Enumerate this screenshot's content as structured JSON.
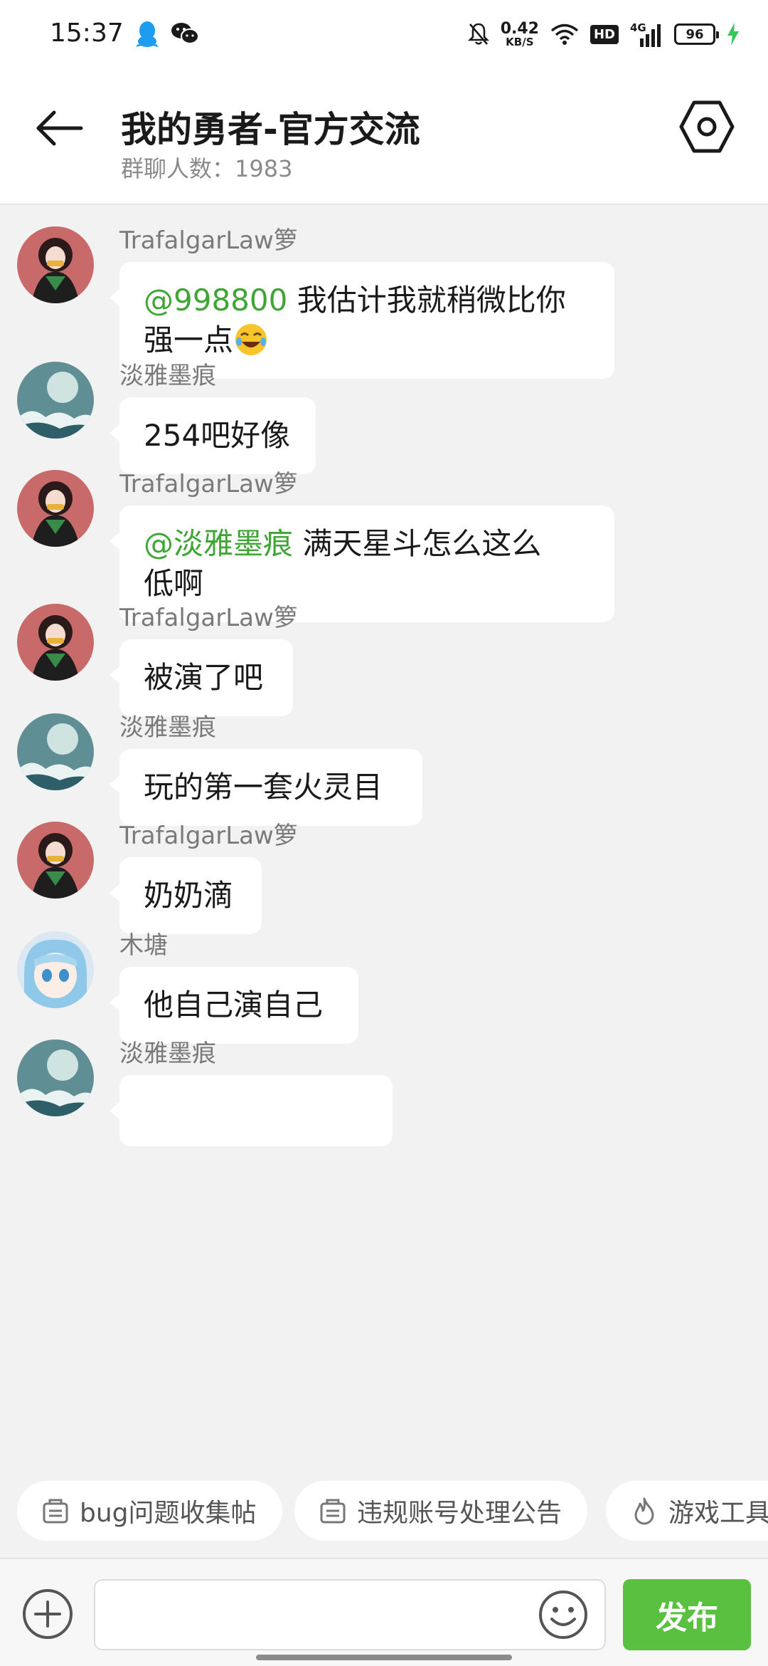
{
  "status_bar": {
    "time": "15:37",
    "net_speed_value": "0.42",
    "net_speed_unit": "KB/S",
    "hd_label": "HD",
    "network_label": "4G",
    "battery_level": "96",
    "icons": [
      "qq-icon",
      "wechat-icon",
      "mute-icon",
      "wifi-icon",
      "signal-icon",
      "charging-icon"
    ]
  },
  "header": {
    "title": "我的勇者-官方交流",
    "member_count": "群聊人数：1983"
  },
  "messages": [
    {
      "sender": "TrafalgarLaw箩",
      "mention": "@998800",
      "text": " 我估计我就稍微比你",
      "text2": "强一点",
      "emoji": "joy"
    },
    {
      "sender": "淡雅墨痕",
      "text": "254吧好像"
    },
    {
      "sender": "TrafalgarLaw箩",
      "mention": "@淡雅墨痕",
      "text": " 满天星斗怎么这么",
      "text2": "低啊"
    },
    {
      "sender": "TrafalgarLaw箩",
      "text": "被演了吧"
    },
    {
      "sender": "淡雅墨痕",
      "text": "玩的第一套火灵目"
    },
    {
      "sender": "TrafalgarLaw箩",
      "text": "奶奶滴"
    },
    {
      "sender": "木塘",
      "text": "他自己演自己"
    },
    {
      "sender": "淡雅墨痕"
    }
  ],
  "quick_links": [
    {
      "label": "bug问题收集帖",
      "icon": "notice-icon"
    },
    {
      "label": "违规账号处理公告",
      "icon": "notice-icon"
    },
    {
      "label": "游戏工具",
      "icon": "fire-icon"
    }
  ],
  "input_bar": {
    "placeholder": "",
    "send_label": "发布"
  },
  "colors": {
    "accent_green": "#5ac03f",
    "mention_green": "#3fa535",
    "background": "#f2f2f2"
  }
}
